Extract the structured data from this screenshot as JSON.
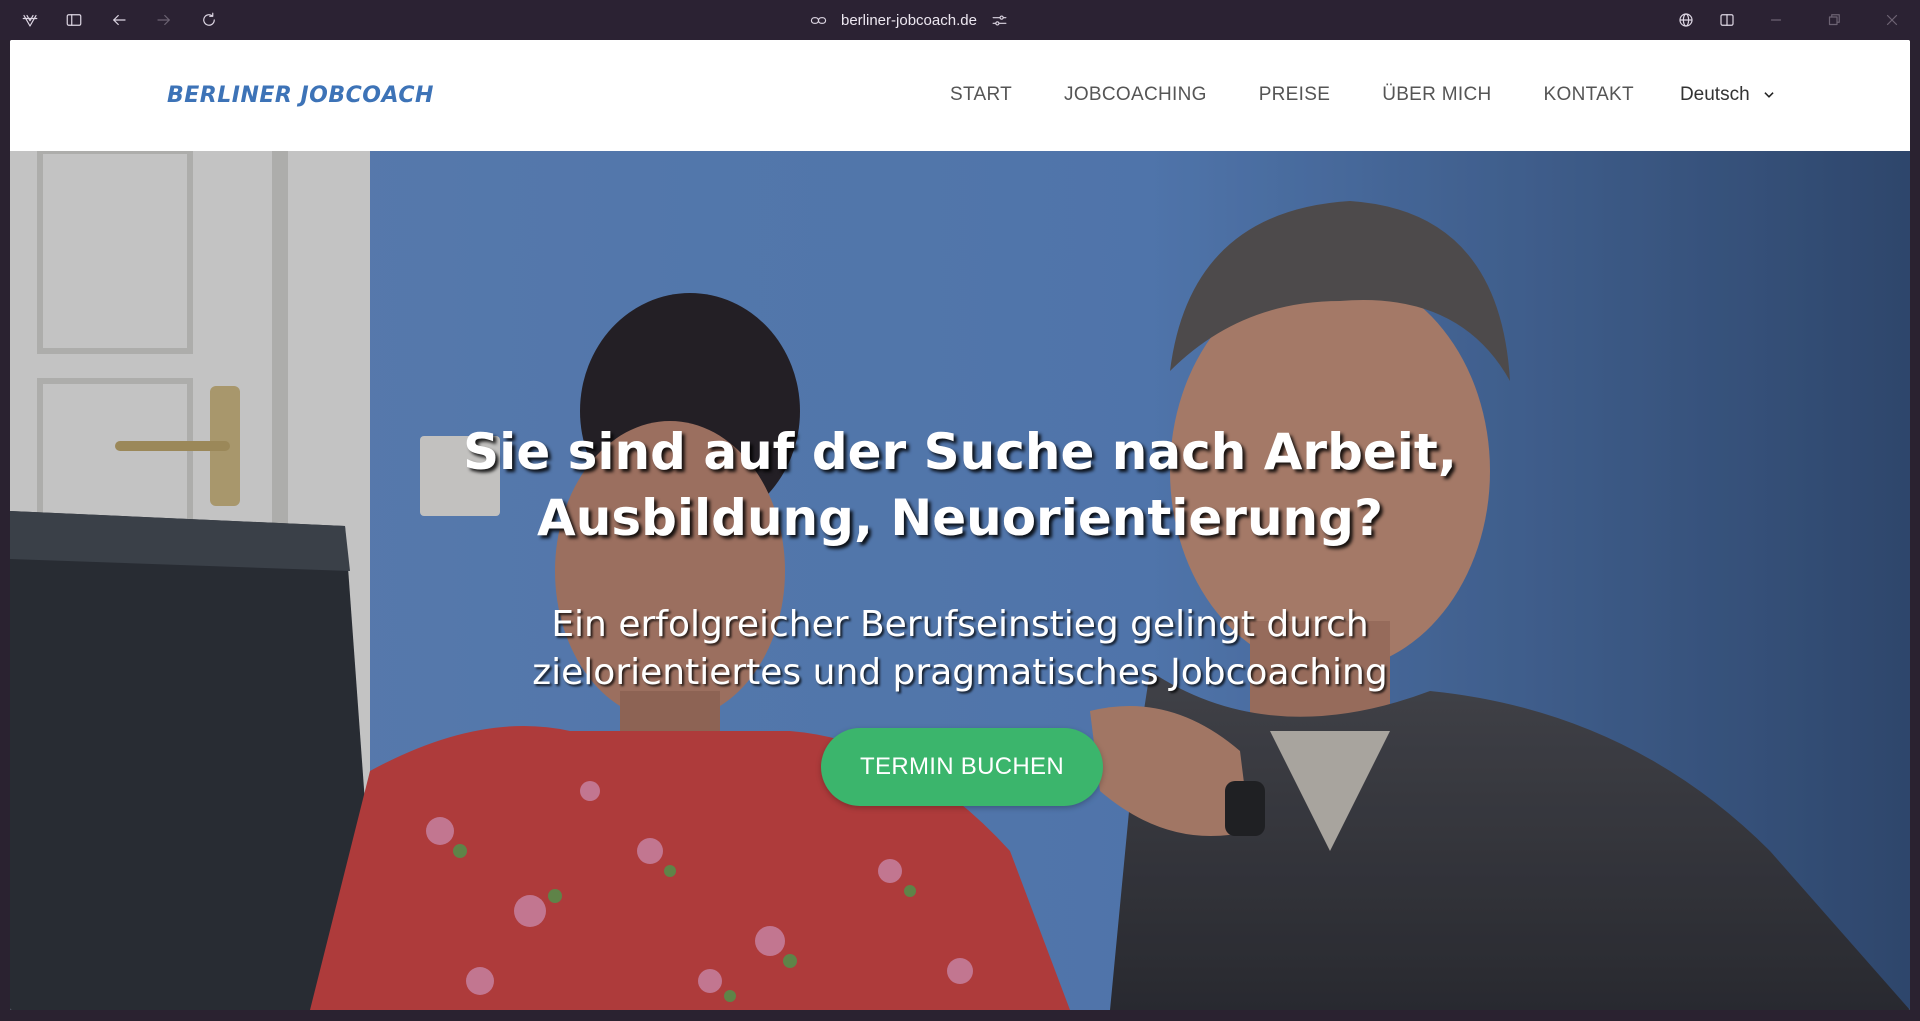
{
  "browser": {
    "url": "berliner-jobcoach.de",
    "icons": [
      "vivaldi-logo-icon",
      "sidebar-toggle-icon",
      "back-icon",
      "forward-icon",
      "reload-icon",
      "link-icon",
      "site-settings-icon",
      "globe-icon",
      "split-view-icon",
      "minimize-icon",
      "restore-icon",
      "close-icon"
    ]
  },
  "header": {
    "logo": "BERLINER JOBCOACH",
    "nav": [
      {
        "label": "START"
      },
      {
        "label": "JOBCOACHING"
      },
      {
        "label": "PREISE"
      },
      {
        "label": "ÜBER MICH"
      },
      {
        "label": "KONTAKT"
      }
    ],
    "language": "Deutsch"
  },
  "hero": {
    "title_line1": "Sie sind auf der Suche nach Arbeit,",
    "title_line2": "Ausbildung, Neuorientierung?",
    "subtitle_line1": "Ein erfolgreicher Berufseinstieg gelingt durch",
    "subtitle_line2": "zielorientiertes und pragmatisches Jobcoaching",
    "cta_label": "TERMIN BUCHEN"
  },
  "colors": {
    "logo": "#3d73b7",
    "cta": "#3bb56c",
    "chrome": "#2b2233",
    "hero_wall": "#5d8cc9"
  }
}
